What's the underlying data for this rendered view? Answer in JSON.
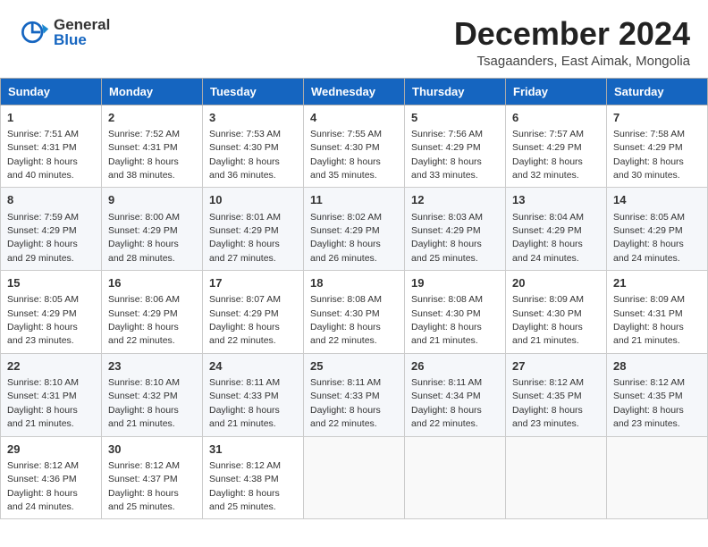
{
  "header": {
    "logo_general": "General",
    "logo_blue": "Blue",
    "month_title": "December 2024",
    "location": "Tsagaanders, East Aimak, Mongolia"
  },
  "weekdays": [
    "Sunday",
    "Monday",
    "Tuesday",
    "Wednesday",
    "Thursday",
    "Friday",
    "Saturday"
  ],
  "weeks": [
    [
      {
        "day": "1",
        "sunrise": "Sunrise: 7:51 AM",
        "sunset": "Sunset: 4:31 PM",
        "daylight": "Daylight: 8 hours and 40 minutes."
      },
      {
        "day": "2",
        "sunrise": "Sunrise: 7:52 AM",
        "sunset": "Sunset: 4:31 PM",
        "daylight": "Daylight: 8 hours and 38 minutes."
      },
      {
        "day": "3",
        "sunrise": "Sunrise: 7:53 AM",
        "sunset": "Sunset: 4:30 PM",
        "daylight": "Daylight: 8 hours and 36 minutes."
      },
      {
        "day": "4",
        "sunrise": "Sunrise: 7:55 AM",
        "sunset": "Sunset: 4:30 PM",
        "daylight": "Daylight: 8 hours and 35 minutes."
      },
      {
        "day": "5",
        "sunrise": "Sunrise: 7:56 AM",
        "sunset": "Sunset: 4:29 PM",
        "daylight": "Daylight: 8 hours and 33 minutes."
      },
      {
        "day": "6",
        "sunrise": "Sunrise: 7:57 AM",
        "sunset": "Sunset: 4:29 PM",
        "daylight": "Daylight: 8 hours and 32 minutes."
      },
      {
        "day": "7",
        "sunrise": "Sunrise: 7:58 AM",
        "sunset": "Sunset: 4:29 PM",
        "daylight": "Daylight: 8 hours and 30 minutes."
      }
    ],
    [
      {
        "day": "8",
        "sunrise": "Sunrise: 7:59 AM",
        "sunset": "Sunset: 4:29 PM",
        "daylight": "Daylight: 8 hours and 29 minutes."
      },
      {
        "day": "9",
        "sunrise": "Sunrise: 8:00 AM",
        "sunset": "Sunset: 4:29 PM",
        "daylight": "Daylight: 8 hours and 28 minutes."
      },
      {
        "day": "10",
        "sunrise": "Sunrise: 8:01 AM",
        "sunset": "Sunset: 4:29 PM",
        "daylight": "Daylight: 8 hours and 27 minutes."
      },
      {
        "day": "11",
        "sunrise": "Sunrise: 8:02 AM",
        "sunset": "Sunset: 4:29 PM",
        "daylight": "Daylight: 8 hours and 26 minutes."
      },
      {
        "day": "12",
        "sunrise": "Sunrise: 8:03 AM",
        "sunset": "Sunset: 4:29 PM",
        "daylight": "Daylight: 8 hours and 25 minutes."
      },
      {
        "day": "13",
        "sunrise": "Sunrise: 8:04 AM",
        "sunset": "Sunset: 4:29 PM",
        "daylight": "Daylight: 8 hours and 24 minutes."
      },
      {
        "day": "14",
        "sunrise": "Sunrise: 8:05 AM",
        "sunset": "Sunset: 4:29 PM",
        "daylight": "Daylight: 8 hours and 24 minutes."
      }
    ],
    [
      {
        "day": "15",
        "sunrise": "Sunrise: 8:05 AM",
        "sunset": "Sunset: 4:29 PM",
        "daylight": "Daylight: 8 hours and 23 minutes."
      },
      {
        "day": "16",
        "sunrise": "Sunrise: 8:06 AM",
        "sunset": "Sunset: 4:29 PM",
        "daylight": "Daylight: 8 hours and 22 minutes."
      },
      {
        "day": "17",
        "sunrise": "Sunrise: 8:07 AM",
        "sunset": "Sunset: 4:29 PM",
        "daylight": "Daylight: 8 hours and 22 minutes."
      },
      {
        "day": "18",
        "sunrise": "Sunrise: 8:08 AM",
        "sunset": "Sunset: 4:30 PM",
        "daylight": "Daylight: 8 hours and 22 minutes."
      },
      {
        "day": "19",
        "sunrise": "Sunrise: 8:08 AM",
        "sunset": "Sunset: 4:30 PM",
        "daylight": "Daylight: 8 hours and 21 minutes."
      },
      {
        "day": "20",
        "sunrise": "Sunrise: 8:09 AM",
        "sunset": "Sunset: 4:30 PM",
        "daylight": "Daylight: 8 hours and 21 minutes."
      },
      {
        "day": "21",
        "sunrise": "Sunrise: 8:09 AM",
        "sunset": "Sunset: 4:31 PM",
        "daylight": "Daylight: 8 hours and 21 minutes."
      }
    ],
    [
      {
        "day": "22",
        "sunrise": "Sunrise: 8:10 AM",
        "sunset": "Sunset: 4:31 PM",
        "daylight": "Daylight: 8 hours and 21 minutes."
      },
      {
        "day": "23",
        "sunrise": "Sunrise: 8:10 AM",
        "sunset": "Sunset: 4:32 PM",
        "daylight": "Daylight: 8 hours and 21 minutes."
      },
      {
        "day": "24",
        "sunrise": "Sunrise: 8:11 AM",
        "sunset": "Sunset: 4:33 PM",
        "daylight": "Daylight: 8 hours and 21 minutes."
      },
      {
        "day": "25",
        "sunrise": "Sunrise: 8:11 AM",
        "sunset": "Sunset: 4:33 PM",
        "daylight": "Daylight: 8 hours and 22 minutes."
      },
      {
        "day": "26",
        "sunrise": "Sunrise: 8:11 AM",
        "sunset": "Sunset: 4:34 PM",
        "daylight": "Daylight: 8 hours and 22 minutes."
      },
      {
        "day": "27",
        "sunrise": "Sunrise: 8:12 AM",
        "sunset": "Sunset: 4:35 PM",
        "daylight": "Daylight: 8 hours and 23 minutes."
      },
      {
        "day": "28",
        "sunrise": "Sunrise: 8:12 AM",
        "sunset": "Sunset: 4:35 PM",
        "daylight": "Daylight: 8 hours and 23 minutes."
      }
    ],
    [
      {
        "day": "29",
        "sunrise": "Sunrise: 8:12 AM",
        "sunset": "Sunset: 4:36 PM",
        "daylight": "Daylight: 8 hours and 24 minutes."
      },
      {
        "day": "30",
        "sunrise": "Sunrise: 8:12 AM",
        "sunset": "Sunset: 4:37 PM",
        "daylight": "Daylight: 8 hours and 25 minutes."
      },
      {
        "day": "31",
        "sunrise": "Sunrise: 8:12 AM",
        "sunset": "Sunset: 4:38 PM",
        "daylight": "Daylight: 8 hours and 25 minutes."
      },
      null,
      null,
      null,
      null
    ]
  ]
}
